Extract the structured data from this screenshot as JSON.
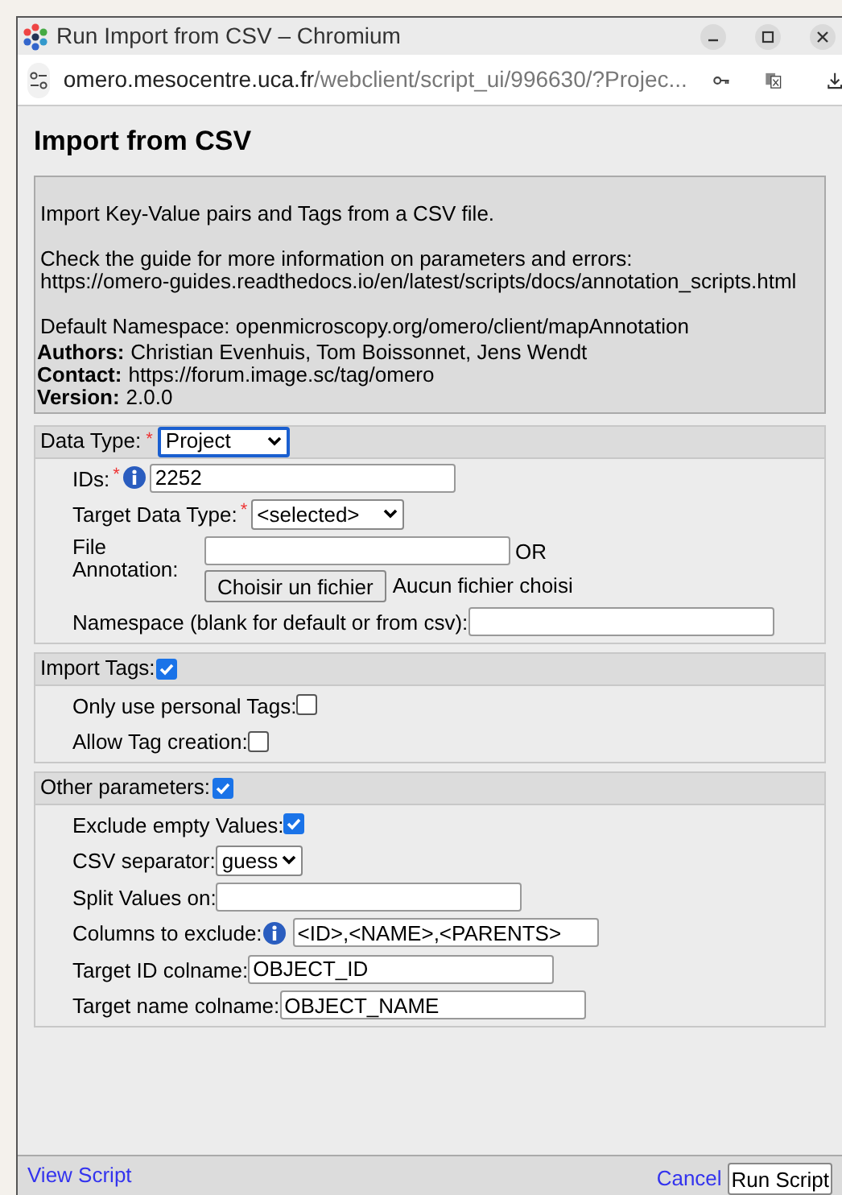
{
  "window": {
    "title": "Run Import from CSV – Chromium"
  },
  "address_bar": {
    "host": "omero.mesocentre.uca.fr",
    "path": "/webclient/script_ui/996630/?Projec..."
  },
  "page": {
    "heading": "Import from CSV",
    "description": [
      [
        "Import Key-Value pairs and Tags from a CSV file."
      ],
      [
        "Check the guide for more information on parameters and errors:",
        "https://omero-guides.readthedocs.io/en/latest/scripts/docs/annotation_scripts.html"
      ],
      [
        "Default Namespace: openmicroscopy.org/omero/client/mapAnnotation"
      ]
    ],
    "meta": [
      {
        "label": "Authors:",
        "value": "Christian Evenhuis, Tom Boissonnet, Jens Wendt"
      },
      {
        "label": "Contact:",
        "value": "https://forum.image.sc/tag/omero"
      },
      {
        "label": "Version:",
        "value": "2.0.0"
      }
    ],
    "sections": [
      {
        "label": "Data Type:",
        "required_mark": "*",
        "kind": "select",
        "value": "Project",
        "focused": true,
        "params": [
          {
            "kind": "text",
            "label": "IDs:",
            "required_mark": "*",
            "info": true,
            "value": "2252"
          },
          {
            "kind": "select",
            "label": "Target Data Type:",
            "required_mark": "*",
            "value": "<selected>"
          },
          {
            "kind": "file",
            "label": "File Annotation:",
            "or_label": "OR",
            "button": "Choisir un fichier",
            "status": "Aucun fichier choisi"
          },
          {
            "kind": "text",
            "label": "Namespace (blank for default or from csv):"
          }
        ]
      },
      {
        "label": "Import Tags:",
        "kind": "checkbox",
        "checked": true,
        "params": [
          {
            "kind": "checkbox",
            "label": "Only use personal Tags:",
            "checked": false
          },
          {
            "kind": "checkbox",
            "label": "Allow Tag creation:",
            "checked": false
          }
        ]
      },
      {
        "label": "Other parameters:",
        "kind": "checkbox",
        "checked": true,
        "params": [
          {
            "kind": "checkbox",
            "label": "Exclude empty Values:",
            "checked": true
          },
          {
            "kind": "select",
            "label": "CSV separator:",
            "value": "guess"
          },
          {
            "kind": "text",
            "label": "Split Values on:"
          },
          {
            "kind": "text",
            "label": "Columns to exclude:",
            "info": true,
            "value": "<ID>,<NAME>,<PARENTS>"
          },
          {
            "kind": "text",
            "label": "Target ID colname:",
            "value": "OBJECT_ID"
          },
          {
            "kind": "text",
            "label": "Target name colname:",
            "value": "OBJECT_NAME"
          }
        ]
      }
    ]
  },
  "footer": {
    "view_script": "View Script",
    "cancel": "Cancel",
    "run": "Run Script"
  }
}
